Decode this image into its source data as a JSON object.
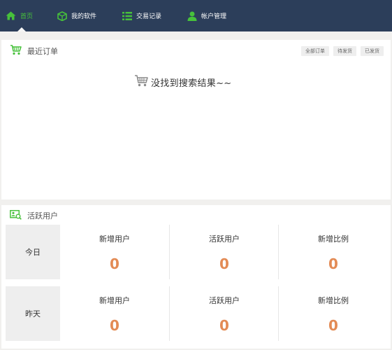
{
  "nav": {
    "items": [
      {
        "label": "首页",
        "icon": "home-icon"
      },
      {
        "label": "我的软件",
        "icon": "box-icon"
      },
      {
        "label": "交易记录",
        "icon": "list-icon"
      },
      {
        "label": "帐户管理",
        "icon": "user-icon"
      }
    ],
    "active_color": "#47c13b",
    "bar_color": "#2c3e5a"
  },
  "orders": {
    "title": "最近订单",
    "filters": [
      "全部订单",
      "待发货",
      "已发货"
    ],
    "empty_message": "没找到搜索结果~~",
    "icon": "shopping-basket-icon"
  },
  "active_users": {
    "title": "活跃用户",
    "icon": "user-chart-icon",
    "value_color": "#e38b55",
    "rows": [
      {
        "day": "今日",
        "stats": [
          {
            "label": "新增用户",
            "value": "0"
          },
          {
            "label": "活跃用户",
            "value": "0"
          },
          {
            "label": "新增比例",
            "value": "0"
          }
        ]
      },
      {
        "day": "昨天",
        "stats": [
          {
            "label": "新增用户",
            "value": "0"
          },
          {
            "label": "活跃用户",
            "value": "0"
          },
          {
            "label": "新增比例",
            "value": "0"
          }
        ]
      }
    ]
  }
}
